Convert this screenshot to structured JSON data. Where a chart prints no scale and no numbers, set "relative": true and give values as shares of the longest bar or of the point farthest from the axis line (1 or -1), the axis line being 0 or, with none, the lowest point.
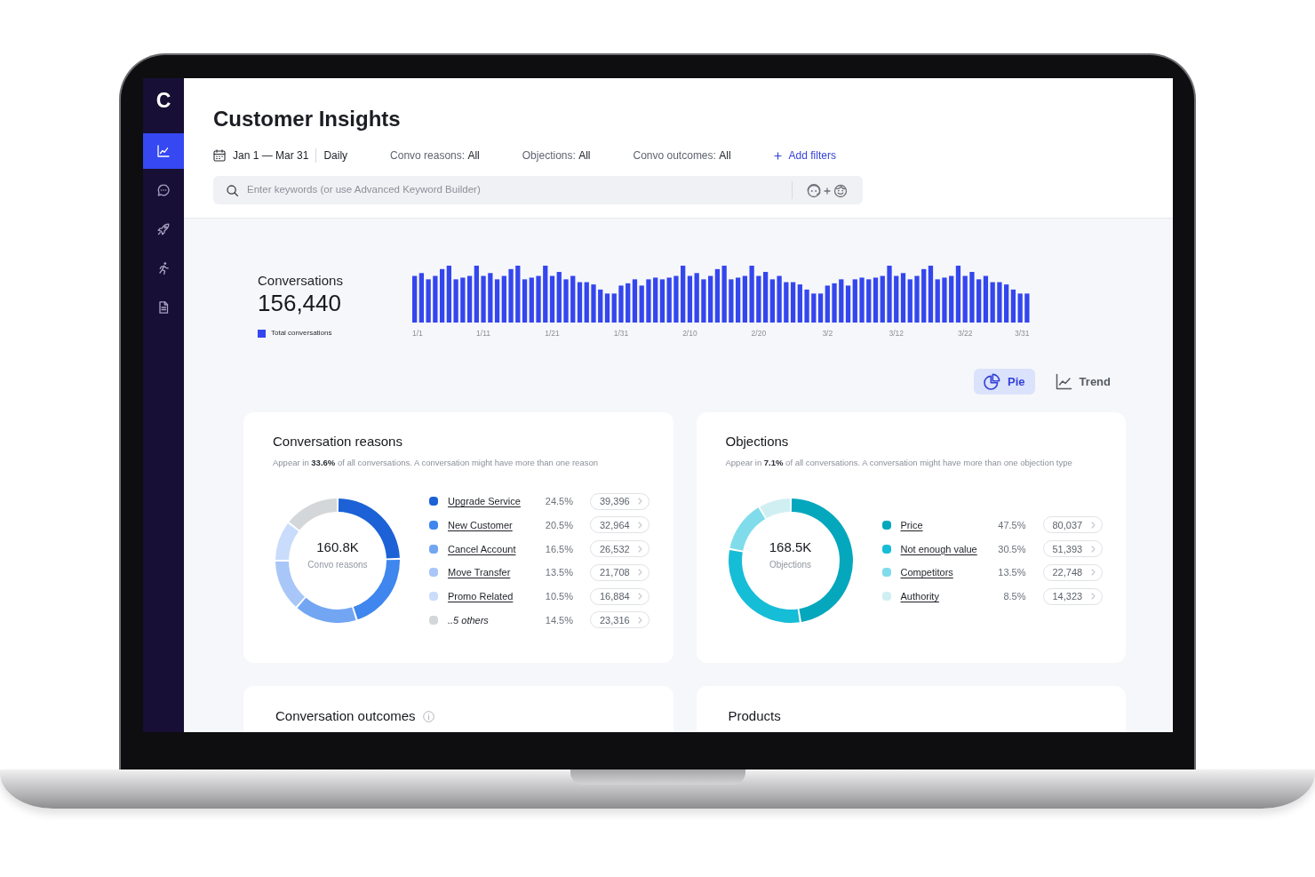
{
  "sidebar": {
    "logo": "C",
    "items": [
      {
        "kind": "chart",
        "selected": true
      },
      {
        "kind": "chat",
        "selected": false
      },
      {
        "kind": "rocket",
        "selected": false
      },
      {
        "kind": "runner",
        "selected": false
      },
      {
        "kind": "document",
        "selected": false
      }
    ]
  },
  "header": {
    "title": "Customer Insights",
    "date_range": "Jan 1 — Mar 31",
    "interval": "Daily",
    "filters": [
      {
        "label": "Convo reasons:",
        "value": "All"
      },
      {
        "label": "Objections:",
        "value": "All"
      },
      {
        "label": "Convo outcomes:",
        "value": "All"
      }
    ],
    "add_filters": "Add filters",
    "search": {
      "placeholder": "Enter keywords (or use Advanced Keyword Builder)"
    }
  },
  "summary": {
    "title": "Conversations",
    "total": "156,440",
    "chart_data": {
      "type": "bar",
      "relative": true,
      "categories": [
        "1/1",
        null,
        null,
        null,
        null,
        null,
        null,
        null,
        null,
        null,
        "1/11",
        null,
        null,
        null,
        null,
        null,
        null,
        null,
        null,
        null,
        "1/21",
        null,
        null,
        null,
        null,
        null,
        null,
        null,
        null,
        null,
        "1/31",
        null,
        null,
        null,
        null,
        null,
        null,
        null,
        null,
        null,
        "2/10",
        null,
        null,
        null,
        null,
        null,
        null,
        null,
        null,
        null,
        "2/20",
        null,
        null,
        null,
        null,
        null,
        null,
        null,
        null,
        null,
        "3/2",
        null,
        null,
        null,
        null,
        null,
        null,
        null,
        null,
        null,
        "3/12",
        null,
        null,
        null,
        null,
        null,
        null,
        null,
        null,
        null,
        "3/22",
        null,
        null,
        null,
        null,
        null,
        null,
        null,
        null,
        "3/31"
      ],
      "series": [
        {
          "name": "Total conversations",
          "color": "#3446ee",
          "values": [
            0.82,
            0.87,
            0.76,
            0.82,
            0.94,
            1.0,
            0.76,
            0.79,
            0.82,
            1.0,
            0.82,
            0.87,
            0.76,
            0.82,
            0.94,
            1.0,
            0.76,
            0.79,
            0.82,
            1.0,
            0.82,
            0.89,
            0.76,
            0.82,
            0.71,
            0.71,
            0.67,
            0.58,
            0.51,
            0.51,
            0.65,
            0.69,
            0.76,
            0.65,
            0.76,
            0.79,
            0.76,
            0.79,
            0.82,
            1.0,
            0.82,
            0.87,
            0.76,
            0.82,
            0.94,
            1.0,
            0.76,
            0.79,
            0.82,
            1.0,
            0.82,
            0.89,
            0.76,
            0.82,
            0.71,
            0.71,
            0.67,
            0.58,
            0.51,
            0.51,
            0.65,
            0.69,
            0.76,
            0.65,
            0.76,
            0.79,
            0.76,
            0.79,
            0.82,
            1.0,
            0.82,
            0.87,
            0.76,
            0.82,
            0.94,
            1.0,
            0.76,
            0.79,
            0.82,
            1.0,
            0.82,
            0.89,
            0.76,
            0.82,
            0.71,
            0.71,
            0.67,
            0.58,
            0.51,
            0.51
          ]
        }
      ]
    }
  },
  "view_toggle": [
    {
      "kind": "pie",
      "label": "Pie",
      "selected": true
    },
    {
      "kind": "trend",
      "label": "Trend",
      "selected": false
    }
  ],
  "cards": [
    {
      "title": "Conversation reasons",
      "subtitle": "Appear in **33.6%** of all conversations. A conversation might have more than one reason",
      "center_value": "160.8K",
      "center_label": "Convo reasons",
      "legend": [
        {
          "kind": "link",
          "label": "Upgrade Service",
          "percent": "24.5%",
          "count": "39,396",
          "color": "#1c61d6"
        },
        {
          "kind": "link",
          "label": "New Customer",
          "percent": "20.5%",
          "count": "32,964",
          "color": "#3f86ee"
        },
        {
          "kind": "link",
          "label": "Cancel Account",
          "percent": "16.5%",
          "count": "26,532",
          "color": "#72a6f3"
        },
        {
          "kind": "link",
          "label": "Move Transfer",
          "percent": "13.5%",
          "count": "21,708",
          "color": "#a8c7f8"
        },
        {
          "kind": "link",
          "label": "Promo Related",
          "percent": "10.5%",
          "count": "16,884",
          "color": "#cadcfb"
        },
        {
          "kind": "more",
          "label": "..5 others",
          "percent": "14.5%",
          "count": "23,316",
          "color": "#d4d7d9"
        }
      ],
      "chart_data": {
        "type": "donut",
        "values": [
          24.5,
          20.5,
          16.5,
          13.5,
          10.5,
          14.5
        ]
      }
    },
    {
      "title": "Objections",
      "subtitle": "Appear in **7.1%** of all conversations. A conversation might have more than one objection type",
      "center_value": "168.5K",
      "center_label": "Objections",
      "legend": [
        {
          "kind": "link",
          "label": "Price",
          "percent": "47.5%",
          "count": "80,037",
          "color": "#05a7bd"
        },
        {
          "kind": "link",
          "label": "Not enough value",
          "percent": "30.5%",
          "count": "51,393",
          "color": "#16bdd7"
        },
        {
          "kind": "link",
          "label": "Competitors",
          "percent": "13.5%",
          "count": "22,748",
          "color": "#80dcea"
        },
        {
          "kind": "link",
          "label": "Authority",
          "percent": "8.5%",
          "count": "14,323",
          "color": "#d0eff3"
        }
      ],
      "chart_data": {
        "type": "donut",
        "values": [
          47.5,
          30.5,
          13.5,
          8.5
        ]
      }
    }
  ],
  "bottom_cards": [
    {
      "title": "Conversation outcomes",
      "info": true
    },
    {
      "title": "Products",
      "info": false
    }
  ]
}
